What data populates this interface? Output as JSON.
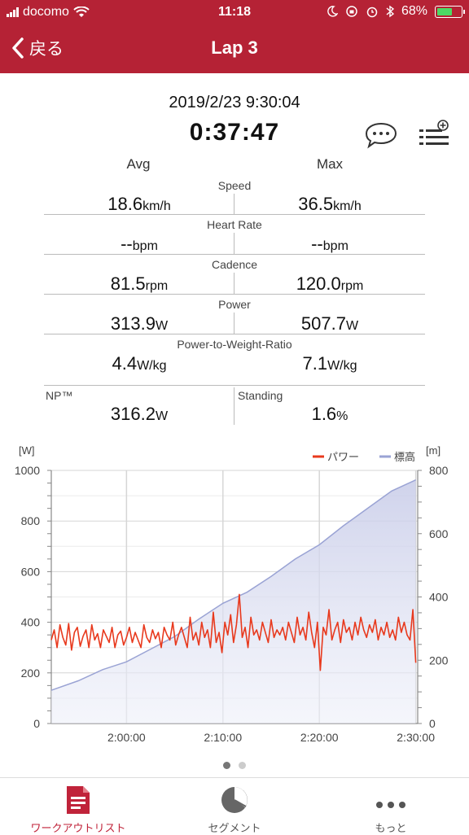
{
  "status": {
    "carrier": "docomo",
    "time": "11:18",
    "battery": "68%",
    "battery_level": 0.68
  },
  "nav": {
    "back_label": "戻る",
    "title": "Lap 3"
  },
  "summary": {
    "date": "2019/2/23 9:30:04",
    "duration": "0:37:47"
  },
  "stats": {
    "avg_header": "Avg",
    "max_header": "Max",
    "rows": [
      {
        "label": "Speed",
        "avg": "18.6",
        "avg_unit": "km/h",
        "max": "36.5",
        "max_unit": "km/h"
      },
      {
        "label": "Heart Rate",
        "avg": "--",
        "avg_unit": "bpm",
        "max": "--",
        "max_unit": "bpm"
      },
      {
        "label": "Cadence",
        "avg": "81.5",
        "avg_unit": "rpm",
        "max": "120.0",
        "max_unit": "rpm"
      },
      {
        "label": "Power",
        "avg": "313.9",
        "avg_unit": "W",
        "max": "507.7",
        "max_unit": "W"
      },
      {
        "label": "Power-to-Weight-Ratio",
        "avg": "4.4",
        "avg_unit": "W/kg",
        "max": "7.1",
        "max_unit": "W/kg"
      }
    ],
    "bottom": {
      "left_label": "NP™",
      "left_value": "316.2",
      "left_unit": "W",
      "right_label": "Standing",
      "right_value": "1.6",
      "right_unit": "%"
    }
  },
  "chart_data": {
    "type": "line",
    "left_axis_unit": "[W]",
    "right_axis_unit": "[m]",
    "ylim_left": [
      0,
      1000
    ],
    "ylim_right": [
      0,
      800
    ],
    "yticks_left": [
      "0",
      "200",
      "400",
      "600",
      "800",
      "1000"
    ],
    "yticks_right": [
      "0",
      "200",
      "400",
      "600",
      "800"
    ],
    "xticks": [
      "2:00:00",
      "2:10:00",
      "2:20:00",
      "2:30:00"
    ],
    "xtick_minutes": [
      120,
      130,
      140,
      150
    ],
    "xlim_minutes": [
      112.2,
      150.2
    ],
    "legend": [
      {
        "name": "パワー",
        "color": "#e8391d"
      },
      {
        "name": "標高",
        "color": "#9aa3d4"
      }
    ],
    "series": [
      {
        "name": "パワー",
        "axis": "left",
        "color": "#e8391d",
        "x": [
          112.2,
          112.5,
          112.8,
          113.1,
          113.4,
          113.7,
          114.0,
          114.3,
          114.6,
          114.9,
          115.2,
          115.5,
          115.8,
          116.1,
          116.4,
          116.7,
          117.0,
          117.3,
          117.6,
          117.9,
          118.2,
          118.5,
          118.8,
          119.1,
          119.4,
          119.7,
          120.0,
          120.3,
          120.6,
          120.9,
          121.2,
          121.5,
          121.8,
          122.1,
          122.4,
          122.7,
          123.0,
          123.3,
          123.6,
          123.9,
          124.2,
          124.5,
          124.8,
          125.1,
          125.4,
          125.7,
          126.0,
          126.3,
          126.6,
          126.9,
          127.2,
          127.5,
          127.8,
          128.1,
          128.4,
          128.7,
          129.0,
          129.3,
          129.6,
          129.9,
          130.2,
          130.5,
          130.8,
          131.1,
          131.4,
          131.7,
          132.0,
          132.3,
          132.6,
          132.9,
          133.2,
          133.5,
          133.8,
          134.1,
          134.4,
          134.7,
          135.0,
          135.3,
          135.6,
          135.9,
          136.2,
          136.5,
          136.8,
          137.1,
          137.4,
          137.7,
          138.0,
          138.3,
          138.6,
          138.9,
          139.2,
          139.5,
          139.8,
          140.1,
          140.4,
          140.7,
          141.0,
          141.3,
          141.6,
          141.9,
          142.2,
          142.5,
          142.8,
          143.1,
          143.4,
          143.7,
          144.0,
          144.3,
          144.6,
          144.9,
          145.2,
          145.5,
          145.8,
          146.1,
          146.4,
          146.7,
          147.0,
          147.3,
          147.6,
          147.9,
          148.2,
          148.5,
          148.8,
          149.1,
          149.4,
          149.7,
          150.0
        ],
        "values": [
          330,
          370,
          300,
          390,
          340,
          310,
          395,
          290,
          360,
          380,
          305,
          345,
          370,
          300,
          390,
          330,
          355,
          300,
          370,
          345,
          320,
          380,
          300,
          350,
          365,
          310,
          340,
          380,
          320,
          360,
          330,
          300,
          390,
          340,
          320,
          370,
          335,
          360,
          300,
          380,
          350,
          330,
          400,
          310,
          350,
          380,
          340,
          300,
          420,
          330,
          360,
          310,
          400,
          340,
          370,
          300,
          440,
          320,
          360,
          280,
          400,
          350,
          430,
          320,
          390,
          510,
          340,
          380,
          300,
          420,
          350,
          370,
          330,
          400,
          360,
          320,
          410,
          340,
          370,
          350,
          380,
          330,
          400,
          360,
          320,
          420,
          350,
          380,
          330,
          440,
          360,
          300,
          400,
          210,
          380,
          350,
          450,
          330,
          370,
          400,
          320,
          410,
          360,
          380,
          330,
          400,
          350,
          420,
          370,
          340,
          390,
          360,
          410,
          330,
          380,
          350,
          400,
          340,
          370,
          330,
          420,
          360,
          400,
          350,
          330,
          450,
          240
        ],
        "peaks": [
          {
            "x": 131.7,
            "y": 510
          },
          {
            "x": 140.1,
            "y": 210
          },
          {
            "x": 150.1,
            "y": 240
          }
        ]
      },
      {
        "name": "標高",
        "axis": "right",
        "color": "#9aa3d4",
        "x": [
          112.2,
          115.0,
          117.5,
          120.0,
          122.5,
          125.0,
          127.5,
          130.0,
          132.5,
          135.0,
          137.5,
          140.0,
          142.5,
          145.0,
          147.5,
          150.0
        ],
        "values": [
          105,
          135,
          170,
          195,
          235,
          275,
          330,
          380,
          415,
          465,
          520,
          565,
          625,
          680,
          735,
          770
        ]
      }
    ]
  },
  "pager": {
    "pages": 2,
    "current": 1
  },
  "tabs": [
    {
      "label": "ワークアウトリスト",
      "icon": "workout-list-icon",
      "active": true
    },
    {
      "label": "セグメント",
      "icon": "segment-icon",
      "active": false
    },
    {
      "label": "もっと",
      "icon": "more-icon",
      "active": false
    }
  ],
  "colors": {
    "brand": "#b52235",
    "power": "#e8391d",
    "elevation": "#9aa3d4",
    "tab_active": "#c0233a"
  }
}
